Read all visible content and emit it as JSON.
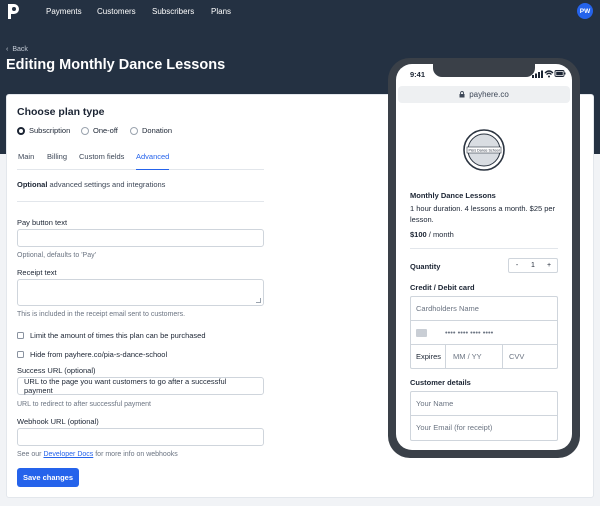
{
  "nav": {
    "items": [
      "Payments",
      "Customers",
      "Subscribers",
      "Plans"
    ],
    "avatar_initials": "PW"
  },
  "header": {
    "back_label": "Back",
    "title": "Editing Monthly Dance Lessons"
  },
  "plan_type": {
    "title": "Choose plan type",
    "options": [
      "Subscription",
      "One-off",
      "Donation"
    ],
    "selected": "Subscription"
  },
  "tabs": [
    "Main",
    "Billing",
    "Custom fields",
    "Advanced"
  ],
  "active_tab": "Advanced",
  "advanced": {
    "intro_bold": "Optional",
    "intro_rest": " advanced settings and integrations",
    "pay_button": {
      "label": "Pay button text",
      "value": "",
      "hint": "Optional, defaults to 'Pay'"
    },
    "receipt": {
      "label": "Receipt text",
      "value": "",
      "hint": "This is included in the receipt email sent to customers."
    },
    "limit_checkbox": "Limit the amount of times this plan can be purchased",
    "hide_checkbox": "Hide from payhere.co/pia-s-dance-school",
    "success_url": {
      "label": "Success URL (optional)",
      "value": "URL to the page you want customers to go after a successful payment",
      "hint": "URL to redirect to after successful payment"
    },
    "webhook_url": {
      "label": "Webhook URL (optional)",
      "value": "",
      "hint_prefix": "See our ",
      "hint_link": "Developer Docs",
      "hint_suffix": " for more info on webhooks"
    },
    "save_label": "Save changes"
  },
  "preview": {
    "time": "9:41",
    "url": "payhere.co",
    "logo_text": "Pia's Dance School",
    "plan_name": "Monthly Dance Lessons",
    "description": "1 hour duration. 4 lessons a month. $25 per lesson.",
    "price": "$100",
    "period": " / month",
    "quantity_label": "Quantity",
    "quantity_value": "1",
    "minus": "-",
    "plus": "+",
    "card_title": "Credit / Debit card",
    "cardholder_placeholder": "Cardholders Name",
    "card_number_placeholder": "•••• •••• •••• ••••",
    "expires_label": "Expires",
    "expiry_placeholder": "MM / YY",
    "cvv_placeholder": "CVV",
    "customer_title": "Customer details",
    "name_placeholder": "Your Name",
    "email_placeholder": "Your Email (for receipt)"
  },
  "colors": {
    "header_bg": "#243142",
    "accent": "#2563eb",
    "phone_frame": "#3a4048"
  }
}
